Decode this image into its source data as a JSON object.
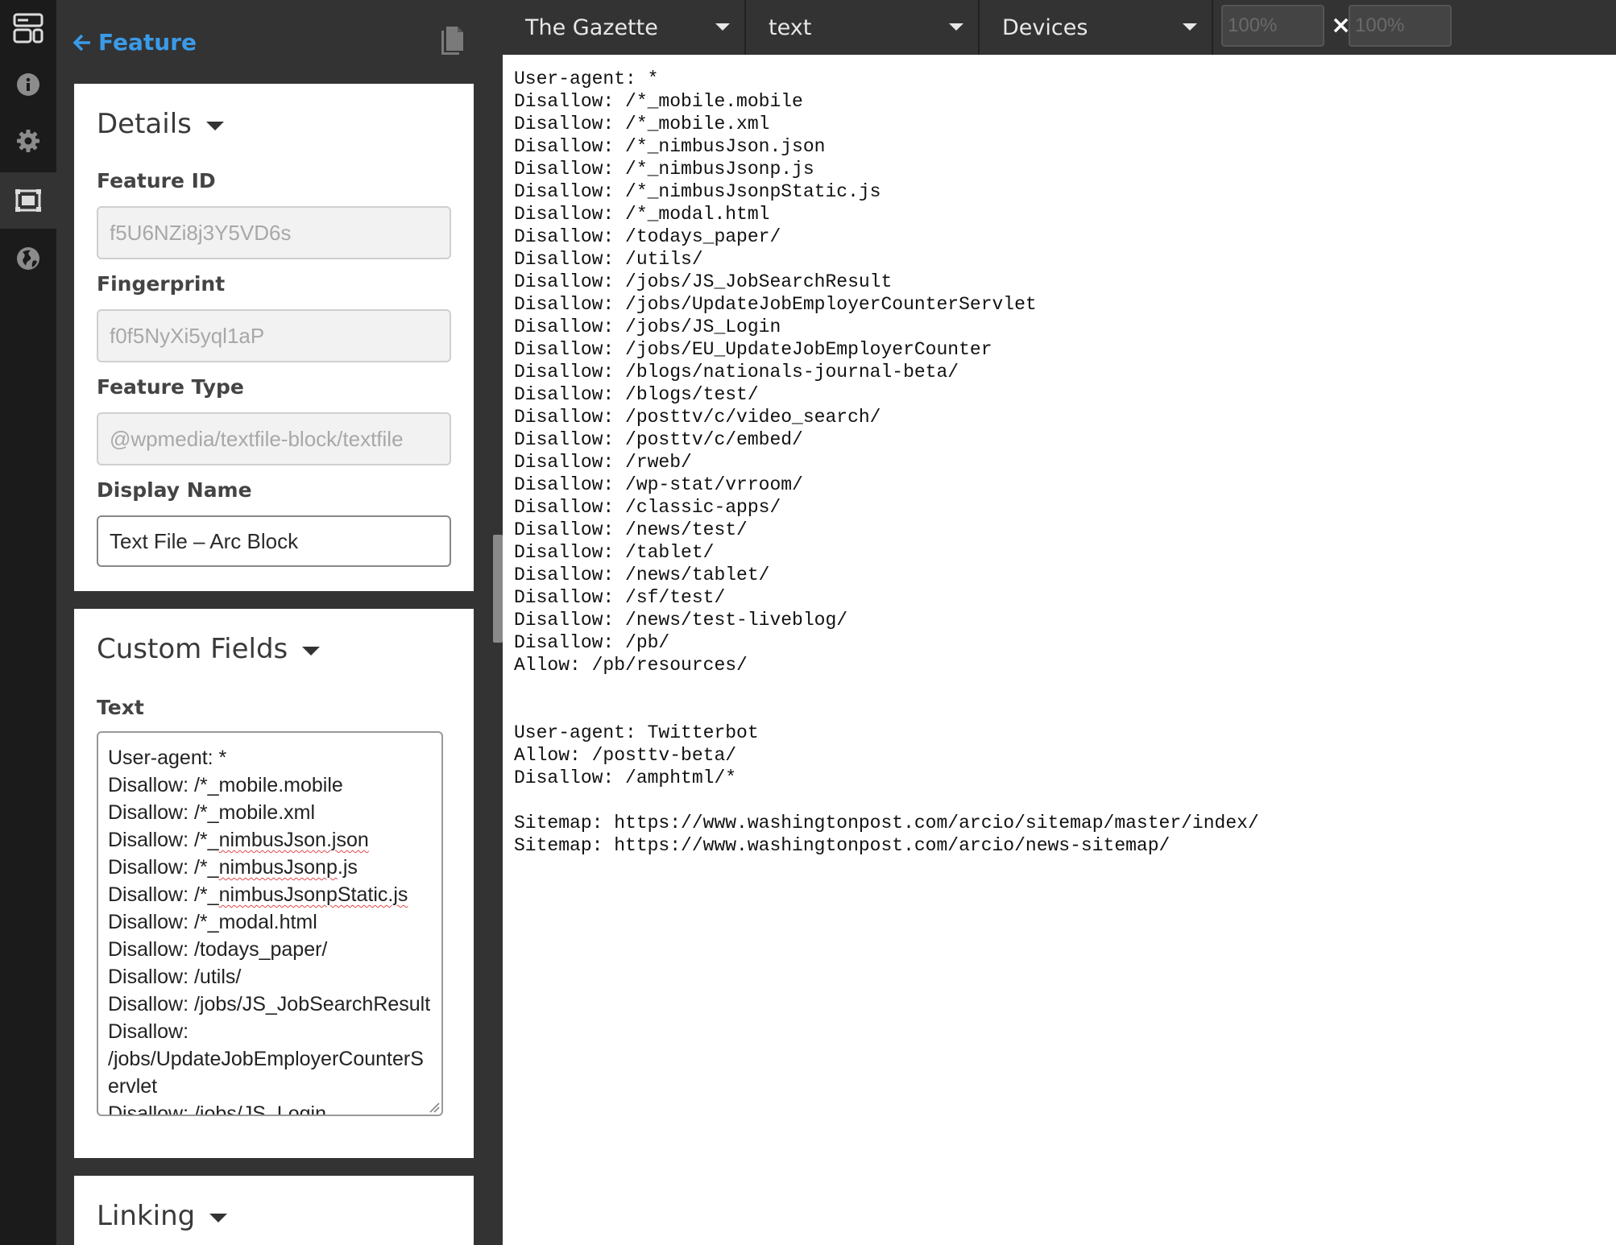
{
  "rail": {
    "items": [
      {
        "icon": "layout-icon",
        "active": false
      },
      {
        "icon": "info-icon",
        "active": false
      },
      {
        "icon": "gear-icon",
        "active": false
      },
      {
        "icon": "feature-frame-icon",
        "active": true
      },
      {
        "icon": "globe-icon",
        "active": false
      }
    ]
  },
  "header": {
    "back_label": "Feature",
    "copy_icon": "copy-icon"
  },
  "details": {
    "title": "Details",
    "feature_id_label": "Feature ID",
    "feature_id_value": "f5U6NZi8j3Y5VD6s",
    "fingerprint_label": "Fingerprint",
    "fingerprint_value": "f0f5NyXi5yql1aP",
    "feature_type_label": "Feature Type",
    "feature_type_value": "@wpmedia/textfile-block/textfile",
    "display_name_label": "Display Name",
    "display_name_value": "Text File – Arc Block"
  },
  "custom_fields": {
    "title": "Custom Fields",
    "text_label": "Text",
    "text_lines": [
      {
        "prefix": "User-agent: *",
        "squiggle": "",
        "suffix": ""
      },
      {
        "prefix": "Disallow: /*_mobile.mobile",
        "squiggle": "",
        "suffix": ""
      },
      {
        "prefix": "Disallow: /*_mobile.xml",
        "squiggle": "",
        "suffix": ""
      },
      {
        "prefix": "Disallow: /*_",
        "squiggle": "nimbusJson.json",
        "suffix": ""
      },
      {
        "prefix": "Disallow: /*_",
        "squiggle": "nimbusJsonp",
        "suffix": ".js"
      },
      {
        "prefix": "Disallow: /*_",
        "squiggle": "nimbusJsonpStatic.js",
        "suffix": ""
      },
      {
        "prefix": "Disallow: /*_modal.html",
        "squiggle": "",
        "suffix": ""
      },
      {
        "prefix": "Disallow: /todays_paper/",
        "squiggle": "",
        "suffix": ""
      },
      {
        "prefix": "Disallow: /utils/",
        "squiggle": "",
        "suffix": ""
      },
      {
        "prefix": "Disallow: /jobs/JS_JobSearchResult",
        "squiggle": "",
        "suffix": ""
      },
      {
        "prefix": "Disallow:",
        "squiggle": "",
        "suffix": ""
      },
      {
        "prefix": "/jobs/UpdateJobEmployerCounterServlet",
        "squiggle": "",
        "suffix": ""
      },
      {
        "prefix": "Disallow: /jobs/JS_Login",
        "squiggle": "",
        "suffix": ""
      }
    ]
  },
  "linking": {
    "title": "Linking"
  },
  "topbar": {
    "site": "The Gazette",
    "output": "text",
    "devices": "Devices",
    "width_placeholder": "100%",
    "height_placeholder": "100%",
    "times": "×"
  },
  "preview": {
    "lines": [
      "User-agent: *",
      "Disallow: /*_mobile.mobile",
      "Disallow: /*_mobile.xml",
      "Disallow: /*_nimbusJson.json",
      "Disallow: /*_nimbusJsonp.js",
      "Disallow: /*_nimbusJsonpStatic.js",
      "Disallow: /*_modal.html",
      "Disallow: /todays_paper/",
      "Disallow: /utils/",
      "Disallow: /jobs/JS_JobSearchResult",
      "Disallow: /jobs/UpdateJobEmployerCounterServlet",
      "Disallow: /jobs/JS_Login",
      "Disallow: /jobs/EU_UpdateJobEmployerCounter",
      "Disallow: /blogs/nationals-journal-beta/",
      "Disallow: /blogs/test/",
      "Disallow: /posttv/c/video_search/",
      "Disallow: /posttv/c/embed/",
      "Disallow: /rweb/",
      "Disallow: /wp-stat/vrroom/",
      "Disallow: /classic-apps/",
      "Disallow: /news/test/",
      "Disallow: /tablet/",
      "Disallow: /news/tablet/",
      "Disallow: /sf/test/",
      "Disallow: /news/test-liveblog/",
      "Disallow: /pb/",
      "Allow: /pb/resources/",
      "",
      "",
      "User-agent: Twitterbot",
      "Allow: /posttv-beta/",
      "Disallow: /amphtml/*",
      "",
      "Sitemap: https://www.washingtonpost.com/arcio/sitemap/master/index/",
      "Sitemap: https://www.washingtonpost.com/arcio/news-sitemap/"
    ]
  },
  "colors": {
    "accent": "#3a9be8",
    "rail_bg": "#1b1b1b",
    "panel_bg": "#333333"
  }
}
